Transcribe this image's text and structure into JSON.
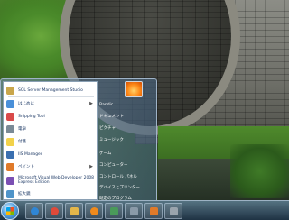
{
  "start_menu": {
    "programs": [
      {
        "label": "SQL Server Management Studio",
        "icon": "sql-server-icon",
        "color": "#c9a64b"
      },
      {
        "label": "はじめに",
        "icon": "getting-started-icon",
        "color": "#4a90d9"
      },
      {
        "label": "Snipping Tool",
        "icon": "scissors-icon",
        "color": "#d94a4a"
      },
      {
        "label": "電卓",
        "icon": "calculator-icon",
        "color": "#7a8a96"
      },
      {
        "label": "付箋",
        "icon": "sticky-notes-icon",
        "color": "#f2d24a"
      },
      {
        "label": "IIS Manager",
        "icon": "iis-icon",
        "color": "#3a6fb0"
      },
      {
        "label": "ペイント",
        "icon": "paint-icon",
        "color": "#e07a2a"
      },
      {
        "label": "Microsoft Visual Web Developer 2008 Express Edition",
        "icon": "visual-web-developer-icon",
        "color": "#7b4fb3"
      },
      {
        "label": "拡大鏡",
        "icon": "magnifier-icon",
        "color": "#4f94c9"
      }
    ],
    "places": [
      {
        "label": "Bandic"
      },
      {
        "label": "ドキュメント"
      },
      {
        "label": "ピクチャ"
      },
      {
        "label": "ミュージック"
      },
      {
        "label": "ゲーム"
      },
      {
        "label": "コンピューター"
      },
      {
        "label": "コントロール パネル"
      },
      {
        "label": "デバイスとプリンター"
      },
      {
        "label": "既定のプログラム"
      }
    ]
  },
  "taskbar": {
    "items": [
      {
        "icon": "internet-explorer-icon",
        "color": "#2f86d6"
      },
      {
        "icon": "chrome-icon",
        "color": "#e04a3a"
      },
      {
        "icon": "folder-icon",
        "color": "#e3b64a"
      },
      {
        "icon": "media-player-icon",
        "color": "#f08a1c"
      },
      {
        "icon": "app-icon",
        "color": "#4a9a5a"
      },
      {
        "icon": "window-icon",
        "color": "#8a9aa8"
      },
      {
        "icon": "paint-icon",
        "color": "#e07a2a"
      },
      {
        "icon": "tool-icon",
        "color": "#9aa4ad"
      }
    ]
  }
}
